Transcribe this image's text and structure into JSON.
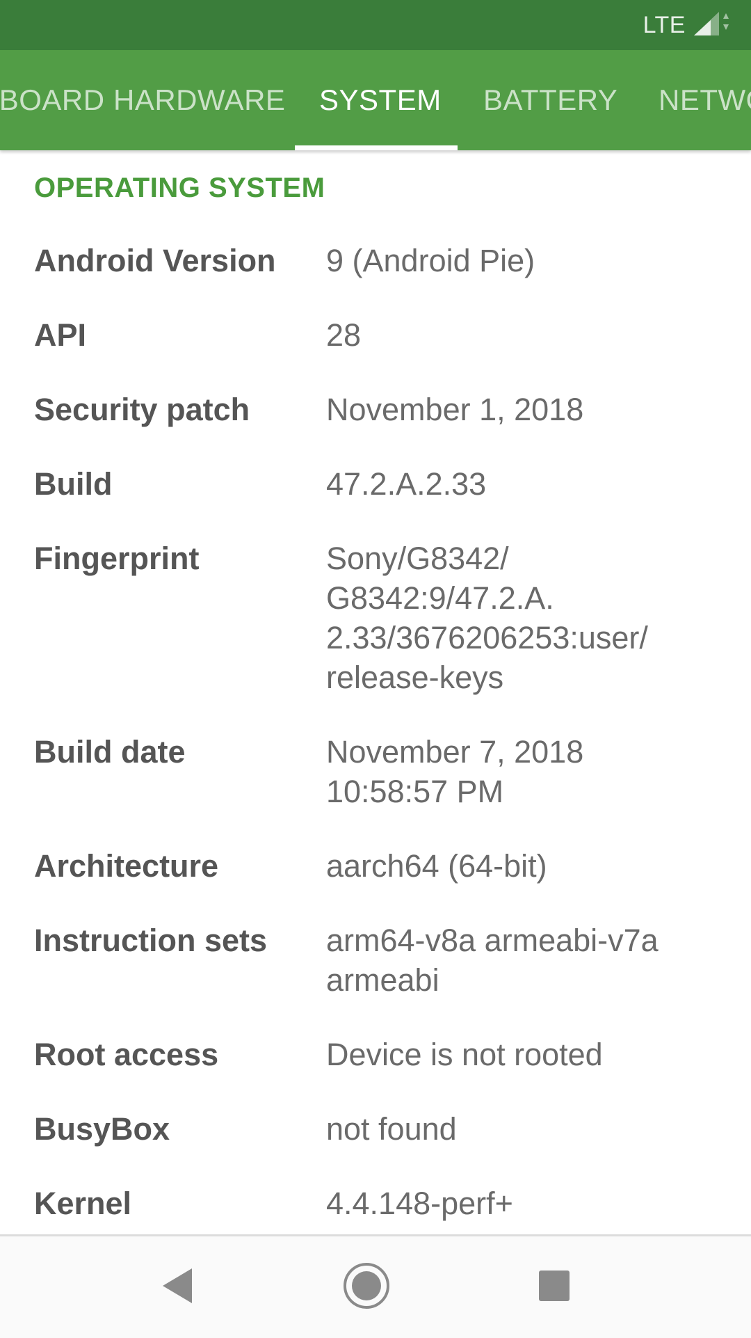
{
  "status_bar": {
    "network": "LTE",
    "icons": [
      "signal-icon"
    ]
  },
  "tabs": [
    {
      "label": "DASHBOARD"
    },
    {
      "label": "HARDWARE"
    },
    {
      "label": "SYSTEM",
      "active": true
    },
    {
      "label": "BATTERY"
    },
    {
      "label": "NETWORK"
    }
  ],
  "section": {
    "title": "OPERATING SYSTEM"
  },
  "rows": [
    {
      "label": "Android Version",
      "value": "9 (Android Pie)"
    },
    {
      "label": "API",
      "value": "28"
    },
    {
      "label": "Security patch",
      "value": "November 1, 2018"
    },
    {
      "label": "Build",
      "value": "47.2.A.2.33"
    },
    {
      "label": "Fingerprint",
      "value": "Sony/G8342/\nG8342:9/47.2.A.\n2.33/3676206253:user/\nrelease-keys"
    },
    {
      "label": "Build date",
      "value": "November 7, 2018\n10:58:57 PM"
    },
    {
      "label": "Architecture",
      "value": "aarch64 (64-bit)"
    },
    {
      "label": "Instruction sets",
      "value": "arm64-v8a armeabi-v7a\narmeabi"
    },
    {
      "label": "Root access",
      "value": "Device is not rooted"
    },
    {
      "label": "BusyBox",
      "value": "not found"
    },
    {
      "label": "Kernel",
      "value": "4.4.148-perf+"
    }
  ],
  "nav": {
    "icons": [
      "back-icon",
      "home-icon",
      "recents-icon"
    ]
  },
  "colors": {
    "status_bar": "#3a7d3a",
    "tab_bar": "#529d46",
    "section_title": "#4a9b3c"
  }
}
